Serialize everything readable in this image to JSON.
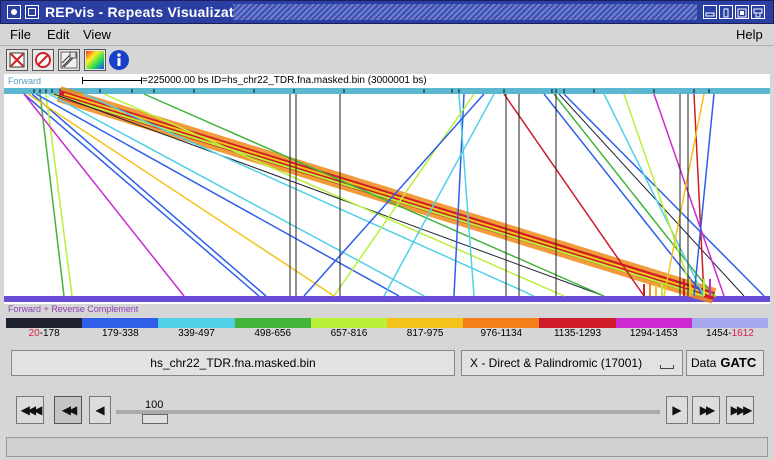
{
  "window": {
    "title": "REPvis - Repeats Visualization"
  },
  "menu": {
    "file": "File",
    "edit": "Edit",
    "view": "View",
    "help": "Help"
  },
  "plot": {
    "top_label": "Forward",
    "ruler_text": "=225000.00 bs  ID=hs_chr22_TDR.fna.masked.bin (3000001 bs)",
    "bottom_label": "Forward + Reverse Complement"
  },
  "legend": [
    {
      "label_red": "20",
      "label": "-178",
      "color": "#1e2230"
    },
    {
      "label_red": "",
      "label": "179-338",
      "color": "#2f5fe8"
    },
    {
      "label_red": "",
      "label": "339-497",
      "color": "#4fd0e8"
    },
    {
      "label_red": "",
      "label": "498-656",
      "color": "#43b43a"
    },
    {
      "label_red": "",
      "label": "657-816",
      "color": "#b8f03a"
    },
    {
      "label_red": "",
      "label": "817-975",
      "color": "#f4c21a"
    },
    {
      "label_red": "",
      "label": "976-1134",
      "color": "#f37e1a"
    },
    {
      "label_red": "",
      "label": "1135-1293",
      "color": "#cf1a2a"
    },
    {
      "label_red": "",
      "label": "1294-1453",
      "color": "#cc2ad0"
    },
    {
      "label_red": "",
      "label": "1454-",
      "color": "#a8a8f0",
      "label_tail_red": "1612"
    }
  ],
  "controls": {
    "filename": "hs_chr22_TDR.fna.masked.bin",
    "mode_select": "X - Direct & Palindromic (17001)",
    "data_label": "Data",
    "data_gatc": "GATC",
    "slider_value": "100"
  }
}
